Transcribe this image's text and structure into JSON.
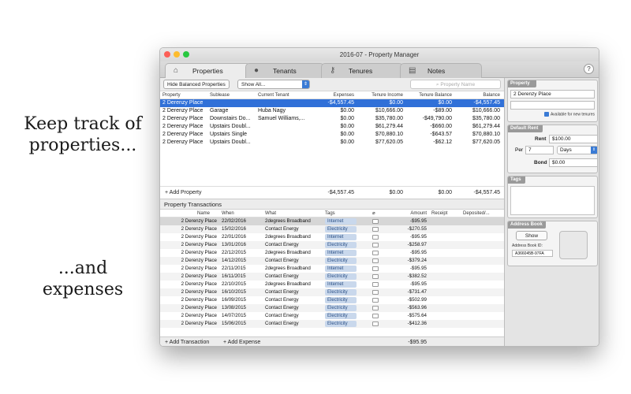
{
  "promo": {
    "line1": "Keep track of properties...",
    "line2": "...and expenses"
  },
  "window": {
    "title": "2016-07 - Property Manager"
  },
  "tabs": [
    {
      "label": "Properties",
      "icon": "house-icon"
    },
    {
      "label": "Tenants",
      "icon": "person-icon"
    },
    {
      "label": "Tenures",
      "icon": "key-icon"
    },
    {
      "label": "Notes",
      "icon": "note-icon"
    }
  ],
  "help_label": "?",
  "toolbar": {
    "hide_balanced": "Hide Balanced Properties",
    "show_select": "Show All...",
    "search_placeholder": "Property Name"
  },
  "properties": {
    "headers": [
      "Property",
      "Sublease",
      "Current Tenant",
      "Expenses",
      "Tenure Income",
      "Tenure Balance",
      "Balance"
    ],
    "rows": [
      [
        "2 Derenzy Place",
        "",
        "",
        "-$4,557.45",
        "$0.00",
        "$0.00",
        "-$4,557.45"
      ],
      [
        "2 Derenzy Place",
        "Garage",
        "Huba Nagy",
        "$0.00",
        "$10,666.00",
        "-$89.00",
        "$10,666.00"
      ],
      [
        "2 Derenzy Place",
        "Downstairs Do...",
        "Samuel Williams,...",
        "$0.00",
        "$35,780.00",
        "-$49,790.00",
        "$35,780.00"
      ],
      [
        "2 Derenzy Place",
        "Upstairs Doubl...",
        "",
        "$0.00",
        "$61,279.44",
        "-$660.00",
        "$61,279.44"
      ],
      [
        "2 Derenzy Place",
        "Upstairs Single",
        "",
        "$0.00",
        "$70,880.10",
        "-$643.57",
        "$70,880.10"
      ],
      [
        "2 Derenzy Place",
        "Upstairs Doubl...",
        "",
        "$0.00",
        "$77,620.05",
        "-$62.12",
        "$77,620.05"
      ]
    ],
    "add_label": "+ Add Property",
    "totals": [
      "-$4,557.45",
      "$0.00",
      "$0.00",
      "-$4,557.45"
    ]
  },
  "transactions": {
    "title": "Property Transactions",
    "headers": [
      "Name",
      "When",
      "What",
      "Tags",
      "⌀",
      "Amount",
      "Receipt",
      "Deposited/..."
    ],
    "rows": [
      [
        "2 Derenzy Place",
        "22/02/2016",
        "2degrees Broadband",
        "Internet",
        "-$95.95"
      ],
      [
        "2 Derenzy Place",
        "15/02/2016",
        "Contact Energy",
        "Electricity",
        "-$270.55"
      ],
      [
        "2 Derenzy Place",
        "22/01/2016",
        "2degrees Broadband",
        "Internet",
        "-$95.95"
      ],
      [
        "2 Derenzy Place",
        "13/01/2016",
        "Contact Energy",
        "Electricity",
        "-$258.97"
      ],
      [
        "2 Derenzy Place",
        "22/12/2015",
        "2degrees Broadband",
        "Internet",
        "-$95.95"
      ],
      [
        "2 Derenzy Place",
        "14/12/2015",
        "Contact Energy",
        "Electricity",
        "-$379.24"
      ],
      [
        "2 Derenzy Place",
        "22/11/2015",
        "2degrees Broadband",
        "Internet",
        "-$95.95"
      ],
      [
        "2 Derenzy Place",
        "16/11/2015",
        "Contact Energy",
        "Electricity",
        "-$382.52"
      ],
      [
        "2 Derenzy Place",
        "22/10/2015",
        "2degrees Broadband",
        "Internet",
        "-$95.95"
      ],
      [
        "2 Derenzy Place",
        "16/10/2015",
        "Contact Energy",
        "Electricity",
        "-$731.47"
      ],
      [
        "2 Derenzy Place",
        "16/09/2015",
        "Contact Energy",
        "Electricity",
        "-$502.99"
      ],
      [
        "2 Derenzy Place",
        "13/08/2015",
        "Contact Energy",
        "Electricity",
        "-$563.96"
      ],
      [
        "2 Derenzy Place",
        "14/07/2015",
        "Contact Energy",
        "Electricity",
        "-$575.64"
      ],
      [
        "2 Derenzy Place",
        "15/06/2015",
        "Contact Energy",
        "Electricity",
        "-$412.36"
      ]
    ],
    "add_transaction": "+ Add Transaction",
    "add_expense": "+ Add Expense",
    "total": "-$95.95"
  },
  "sidebar": {
    "property": {
      "title": "Property",
      "name": "2 Derenzy Place",
      "second": "",
      "available": "Available for new tenures"
    },
    "default_rent": {
      "title": "Default Rent",
      "rent_label": "Rent",
      "rent_value": "$100.00",
      "per_label": "Per",
      "per_value": "7",
      "per_unit": "Days",
      "bond_label": "Bond",
      "bond_value": "$0.00"
    },
    "tags": {
      "title": "Tags"
    },
    "address_book": {
      "title": "Address Book",
      "show": "Show",
      "id_label": "Address Book ID:",
      "id_value": "A366045B-97FA"
    }
  },
  "colors": {
    "selection": "#3070d8",
    "tag_bg": "#c9d8ec"
  }
}
